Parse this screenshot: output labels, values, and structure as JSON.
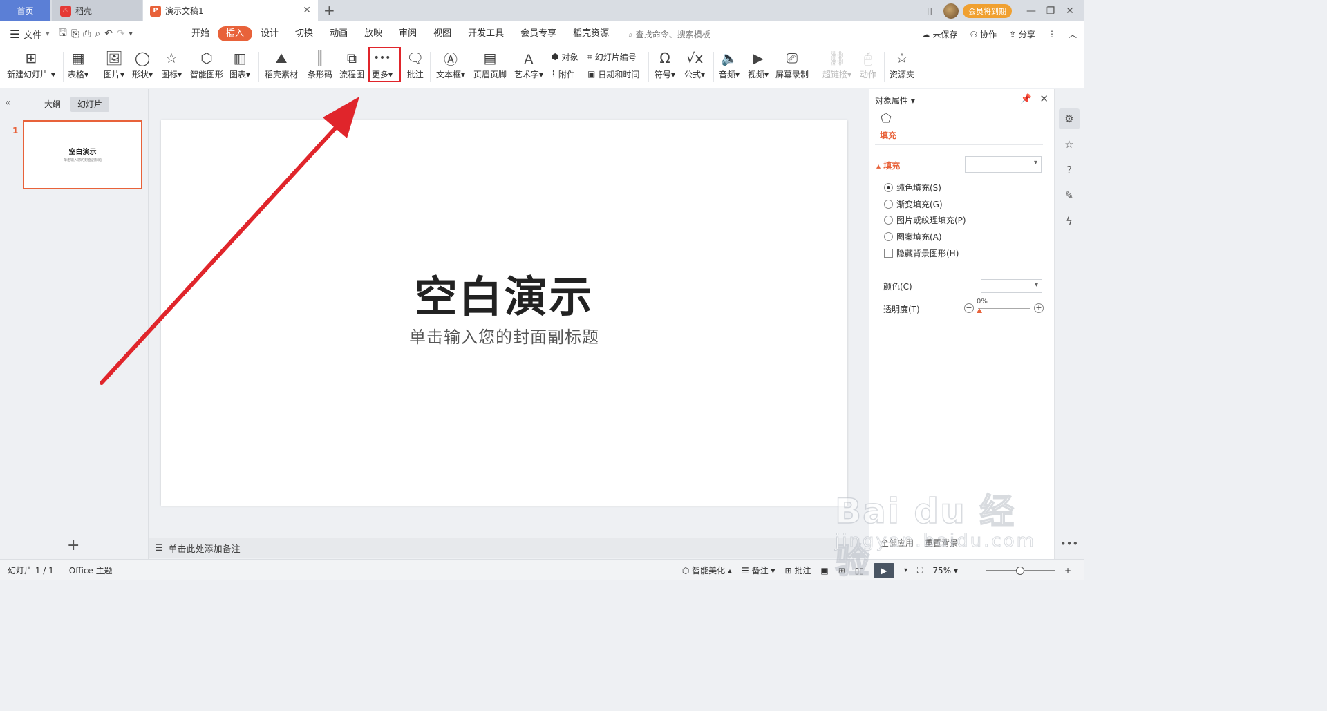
{
  "titlebar": {
    "tab_home": "首页",
    "tab_daoke": "稻壳",
    "tab_doc": "演示文稿1",
    "vip_badge": "会员将到期"
  },
  "menubar": {
    "file": "文件",
    "tabs": [
      "开始",
      "插入",
      "设计",
      "切换",
      "动画",
      "放映",
      "审阅",
      "视图",
      "开发工具",
      "会员专享",
      "稻壳资源"
    ],
    "active_tab": "插入",
    "search_placeholder": "查找命令、搜索模板",
    "unsaved": "未保存",
    "collab": "协作",
    "share": "分享"
  },
  "ribbon": {
    "new_slide": "新建幻灯片",
    "table": "表格",
    "picture": "图片",
    "shape": "形状",
    "icons": "图标",
    "smart_graphic": "智能图形",
    "chart": "图表",
    "daoke_material": "稻壳素材",
    "barcode": "条形码",
    "flowchart": "流程图",
    "more": "更多",
    "comment": "批注",
    "textbox": "文本框",
    "header_footer": "页眉页脚",
    "wordart": "艺术字",
    "object": "对象",
    "slide_number": "幻灯片编号",
    "attachment": "附件",
    "date_time": "日期和时间",
    "symbol": "符号",
    "formula": "公式",
    "audio": "音频",
    "video": "视频",
    "screen_record": "屏幕录制",
    "hyperlink": "超链接",
    "action": "动作",
    "resource_folder": "资源夹"
  },
  "leftpanel": {
    "tab_outline": "大纲",
    "tab_slides": "幻灯片",
    "slide_number": "1",
    "thumb_title": "空白演示",
    "thumb_sub": "单击输入您的封面副标题"
  },
  "slide": {
    "title": "空白演示",
    "subtitle": "单击输入您的封面副标题"
  },
  "notes": {
    "placeholder": "单击此处添加备注"
  },
  "property_pane": {
    "title": "对象属性",
    "fill_tab": "填充",
    "section": "填充",
    "options": [
      "纯色填充(S)",
      "渐变填充(G)",
      "图片或纹理填充(P)",
      "图案填充(A)"
    ],
    "selected_option": 0,
    "hide_bg": "隐藏背景图形(H)",
    "color_label": "颜色(C)",
    "transparency_label": "透明度(T)",
    "transparency_value": "0%",
    "bottom_buttons": [
      "全部应用",
      "重置背景"
    ]
  },
  "statusbar": {
    "slide_count": "幻灯片 1 / 1",
    "theme": "Office 主题",
    "beautify": "智能美化",
    "notes": "备注",
    "comment": "批注",
    "zoom": "75%"
  },
  "watermark": {
    "brand": "Bai du 经验",
    "url": "jingyan.baidu.com"
  },
  "colors": {
    "accent": "#e8623a",
    "highlight": "#e0252b",
    "home_tab": "#5b7fd6"
  }
}
